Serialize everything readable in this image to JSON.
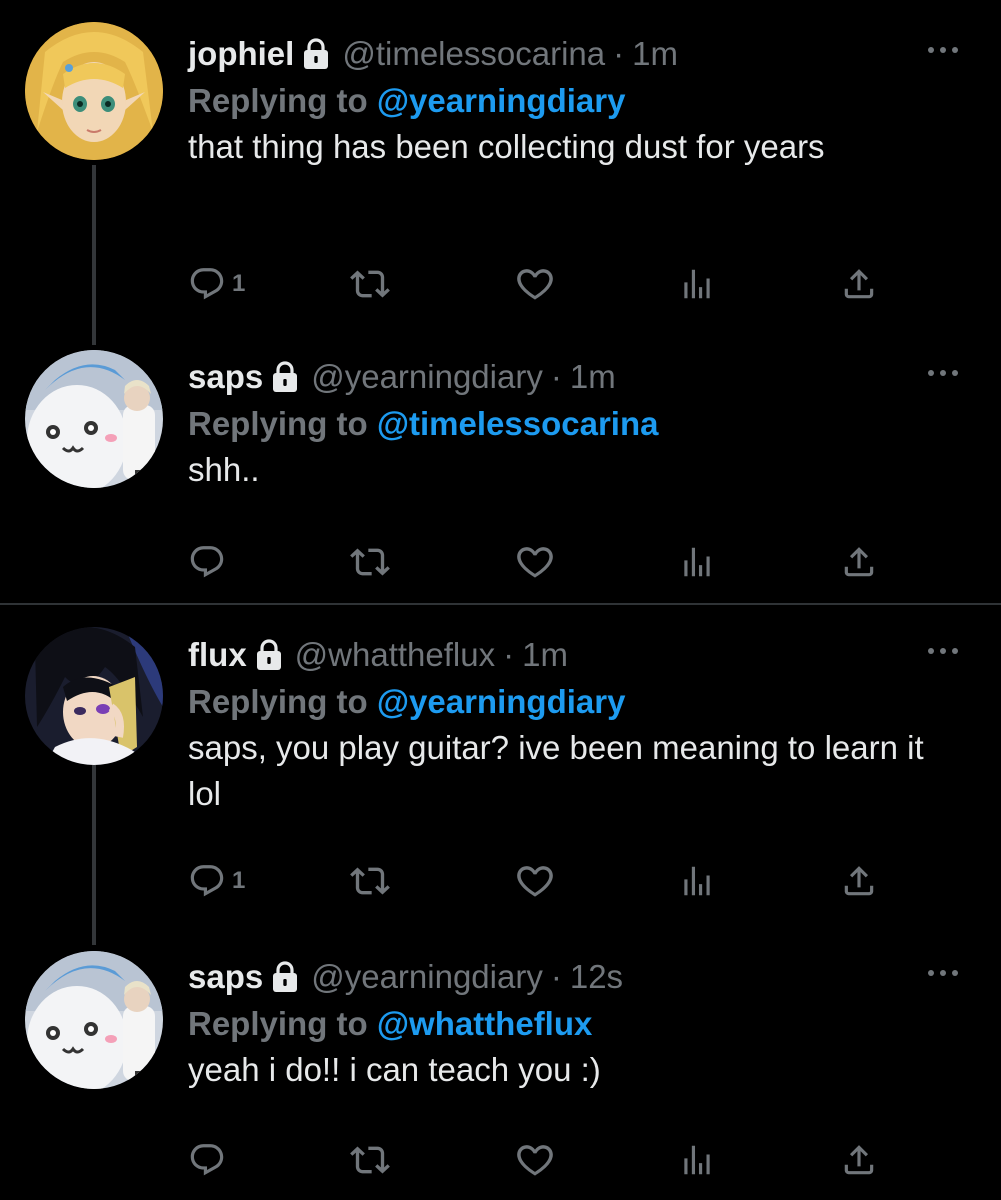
{
  "tweets": [
    {
      "name": "jophiel",
      "handle": "@timelessocarina",
      "dot": "·",
      "time": "1m",
      "replying_label": "Replying to ",
      "replying_handle": "@yearningdiary",
      "text": "that thing has been collecting dust for years",
      "reply_count": "1",
      "avatar": "zelda-avatar"
    },
    {
      "name": "saps",
      "handle": "@yearningdiary",
      "dot": "·",
      "time": "1m",
      "replying_label": "Replying to ",
      "replying_handle": "@timelessocarina",
      "text": "shh..",
      "reply_count": "",
      "avatar": "mascot-avatar"
    },
    {
      "name": "flux",
      "handle": "@whattheflux",
      "dot": "·",
      "time": "1m",
      "replying_label": "Replying to ",
      "replying_handle": "@yearningdiary",
      "text": "saps, you play guitar? ive been meaning to learn it lol",
      "reply_count": "1",
      "avatar": "anime-avatar"
    },
    {
      "name": "saps",
      "handle": "@yearningdiary",
      "dot": "·",
      "time": "12s",
      "replying_label": "Replying to ",
      "replying_handle": "@whattheflux",
      "text": "yeah i do!! i can teach you :)",
      "reply_count": "",
      "avatar": "mascot-avatar"
    }
  ],
  "icons": {
    "reply": "reply-icon",
    "retweet": "retweet-icon",
    "like": "heart-icon",
    "views": "analytics-icon",
    "share": "share-icon",
    "more": "more-options-icon",
    "lock": "lock-icon"
  },
  "colors": {
    "background": "#000000",
    "text": "#e7e9ea",
    "muted": "#71767b",
    "accent": "#1d9bf0",
    "thread_line": "#333639"
  }
}
